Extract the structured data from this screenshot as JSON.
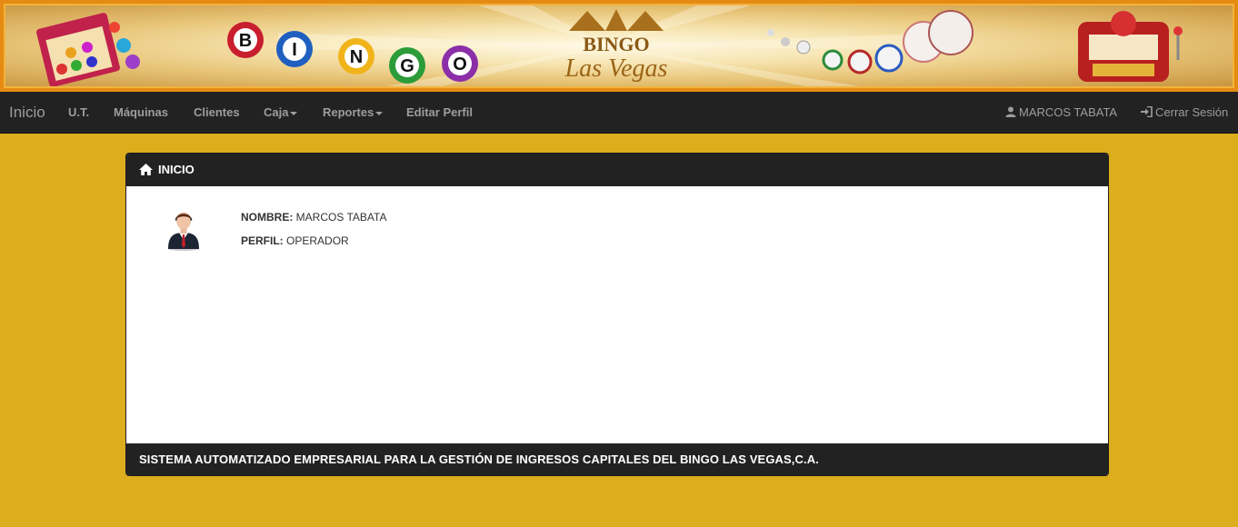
{
  "banner": {
    "bingo_balls": [
      "B",
      "I",
      "N",
      "G",
      "O"
    ],
    "logo_line1": "BINGO",
    "logo_line2": "Las Vegas"
  },
  "navbar": {
    "brand": "Inicio",
    "items": [
      {
        "label": "U.T.",
        "has_dropdown": false
      },
      {
        "label": "Máquinas",
        "has_dropdown": false
      },
      {
        "label": "Clientes",
        "has_dropdown": false
      },
      {
        "label": "Caja",
        "has_dropdown": true
      },
      {
        "label": "Reportes",
        "has_dropdown": true
      },
      {
        "label": "Editar Perfil",
        "has_dropdown": false
      }
    ],
    "user_label": "MARCOS TABATA",
    "user_icon": "user-icon",
    "logout_label": "Cerrar Sesión",
    "logout_icon": "sign-in-icon"
  },
  "panel": {
    "title": "INICIO",
    "title_icon": "home-icon",
    "name_label": "NOMBRE:",
    "name_value": "MARCOS TABATA",
    "profile_label": "PERFIL:",
    "profile_value": "OPERADOR",
    "footer": "SISTEMA AUTOMATIZADO EMPRESARIAL PARA LA GESTIÓN DE INGRESOS CAPITALES DEL BINGO LAS VEGAS,C.A."
  },
  "colors": {
    "page_bg": "#dcae1d",
    "navbar_bg": "#222222",
    "nav_text": "#9d9d9d",
    "banner_frame": "#e58a12"
  }
}
